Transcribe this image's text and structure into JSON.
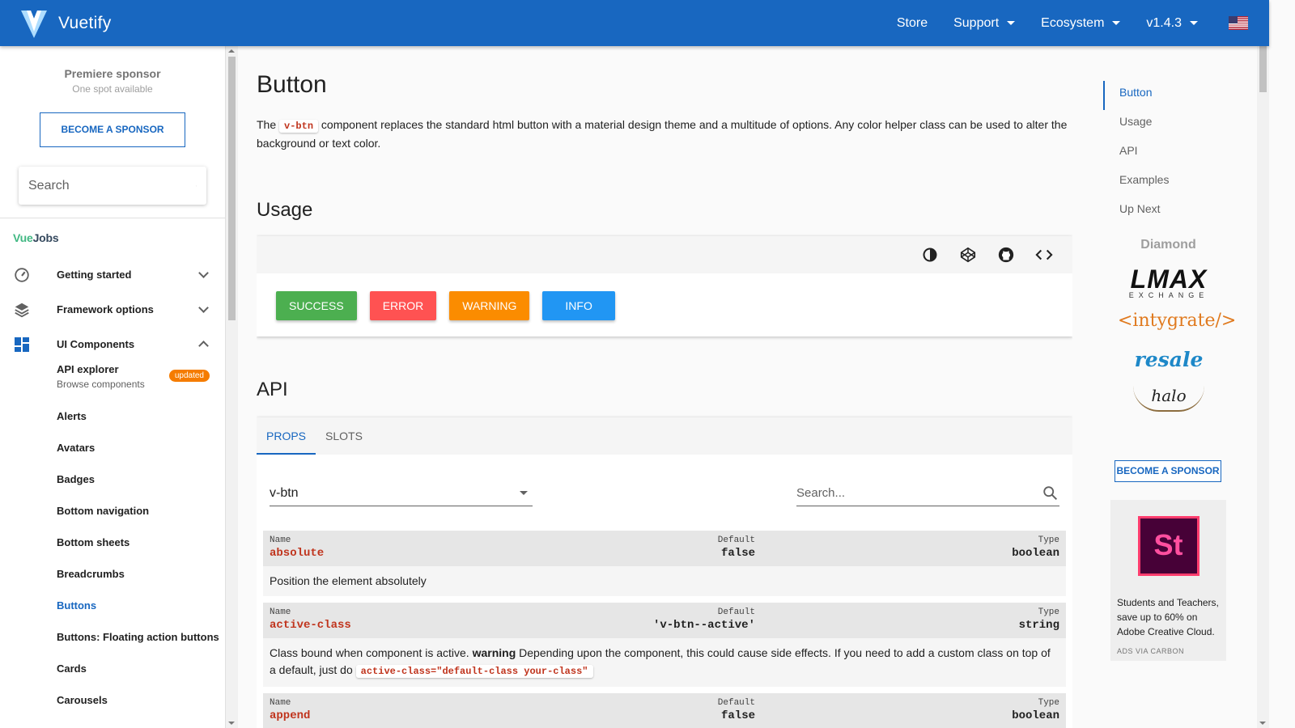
{
  "app": {
    "name": "Vuetify"
  },
  "nav": {
    "store": "Store",
    "support": "Support",
    "ecosystem": "Ecosystem",
    "version": "v1.4.3"
  },
  "sidebar": {
    "sponsor_title": "Premiere sponsor",
    "sponsor_sub": "One spot available",
    "become_sponsor": "BECOME A SPONSOR",
    "search_placeholder": "Search",
    "vuejobs_a": "Vue",
    "vuejobs_b": "Jobs",
    "groups": {
      "getting_started": "Getting started",
      "framework_options": "Framework options",
      "ui_components": "UI Components"
    },
    "api_explorer": {
      "title": "API explorer",
      "subtitle": "Browse components",
      "badge": "updated"
    },
    "items": [
      "Alerts",
      "Avatars",
      "Badges",
      "Bottom navigation",
      "Bottom sheets",
      "Breadcrumbs",
      "Buttons",
      "Buttons: Floating action buttons",
      "Cards",
      "Carousels"
    ]
  },
  "main": {
    "title": "Button",
    "intro_a": "The ",
    "intro_code": "v-btn",
    "intro_b": " component replaces the standard html button with a material design theme and a multitude of options. Any color helper class can be used to alter the background or text color.",
    "usage_heading": "Usage",
    "buttons": {
      "success": "SUCCESS",
      "error": "ERROR",
      "warning": "WARNING",
      "info": "INFO"
    },
    "api_heading": "API",
    "tabs": {
      "props": "PROPS",
      "slots": "SLOTS"
    },
    "component_select": "v-btn",
    "props_search_placeholder": "Search...",
    "col_labels": {
      "name": "Name",
      "default": "Default",
      "type": "Type"
    },
    "props": [
      {
        "name": "absolute",
        "default": "false",
        "type": "boolean",
        "desc": "Position the element absolutely"
      },
      {
        "name": "active-class",
        "default": "'v-btn--active'",
        "type": "string",
        "desc_a": "Class bound when component is active. ",
        "desc_bold": "warning",
        "desc_b": " Depending upon the component, this could cause side effects. If you need to add a custom class on top of a default, just do ",
        "desc_code": "active-class=\"default-class your-class\""
      },
      {
        "name": "append",
        "default": "false",
        "type": "boolean"
      }
    ]
  },
  "toc": {
    "items": [
      "Button",
      "Usage",
      "API",
      "Examples",
      "Up Next"
    ]
  },
  "sponsors": {
    "diamond": "Diamond",
    "lmax_big": "LMAX",
    "lmax_small": "EXCHANGE",
    "intygrate": "<intygrate/>",
    "resale": "resale",
    "halo": "halo",
    "become_sponsor": "BECOME A SPONSOR"
  },
  "carbon": {
    "logo": "St",
    "text": "Students and Teachers, save up to 60% on Adobe Creative Cloud.",
    "via": "ADS VIA CARBON"
  },
  "colors": {
    "primary": "#1867c0",
    "success": "#4caf50",
    "error": "#ff5252",
    "warning": "#fb8c00",
    "info": "#2196f3"
  }
}
